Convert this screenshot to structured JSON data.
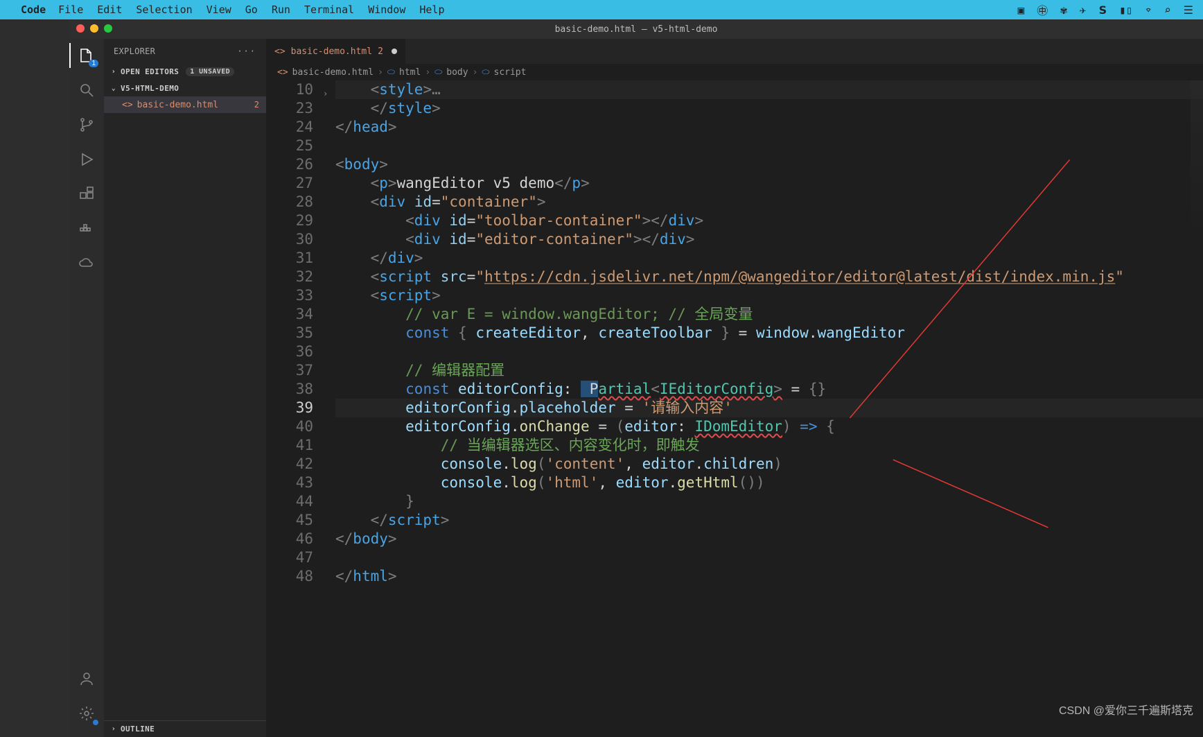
{
  "menubar": {
    "apple_glyph": "",
    "app": "Code",
    "items": [
      "File",
      "Edit",
      "Selection",
      "View",
      "Go",
      "Run",
      "Terminal",
      "Window",
      "Help"
    ]
  },
  "titlebar": "basic-demo.html — v5-html-demo",
  "activity_badge": "1",
  "sidebar": {
    "title": "EXPLORER",
    "open_editors_label": "OPEN EDITORS",
    "unsaved_label": "1 UNSAVED",
    "workspace_label": "V5-HTML-DEMO",
    "file_name": "basic-demo.html",
    "file_problems": "2",
    "outline_label": "OUTLINE"
  },
  "tab": {
    "label": "basic-demo.html",
    "problems": "2"
  },
  "breadcrumbs": [
    "basic-demo.html",
    "html",
    "body",
    "script"
  ],
  "line_numbers": [
    "10",
    "23",
    "24",
    "25",
    "26",
    "27",
    "28",
    "29",
    "30",
    "31",
    "32",
    "33",
    "34",
    "35",
    "36",
    "37",
    "38",
    "39",
    "40",
    "41",
    "42",
    "43",
    "44",
    "45",
    "46",
    "47",
    "48"
  ],
  "active_line_index": 17,
  "fold_markers": [
    0
  ],
  "code": {
    "l0": {
      "a": "    <",
      "b": "style",
      "c": ">",
      "d": "…"
    },
    "l1": {
      "a": "    </",
      "b": "style",
      "c": ">"
    },
    "l2": {
      "a": "</",
      "b": "head",
      "c": ">"
    },
    "l3": "",
    "l4": {
      "a": "<",
      "b": "body",
      "c": ">"
    },
    "l5": {
      "a": "    <",
      "b": "p",
      "c": ">",
      "t": "wangEditor v5 demo",
      "d": "</",
      "e": "p",
      "f": ">"
    },
    "l6": {
      "a": "    <",
      "b": "div",
      "sp": " ",
      "attr": "id",
      "eq": "=",
      "q": "\"",
      "v": "container",
      "q2": "\"",
      "c": ">"
    },
    "l7": {
      "a": "        <",
      "b": "div",
      "sp": " ",
      "attr": "id",
      "eq": "=",
      "q": "\"",
      "v": "toolbar-container",
      "q2": "\"",
      "c": "></",
      "b2": "div",
      "d": ">"
    },
    "l8": {
      "a": "        <",
      "b": "div",
      "sp": " ",
      "attr": "id",
      "eq": "=",
      "q": "\"",
      "v": "editor-container",
      "q2": "\"",
      "c": "></",
      "b2": "div",
      "d": ">"
    },
    "l9": {
      "a": "    </",
      "b": "div",
      "c": ">"
    },
    "l10": {
      "a": "    <",
      "b": "script",
      "sp": " ",
      "attr": "src",
      "eq": "=",
      "q": "\"",
      "url": "https://cdn.jsdelivr.net/npm/@wangeditor/editor@latest/dist/index.min.js",
      "q2": "\""
    },
    "l11": {
      "a": "    <",
      "b": "script",
      "c": ">"
    },
    "l12": {
      "c1": "        // var E = window.wangEditor; // ",
      "c2": "全局变量"
    },
    "l13": {
      "ind": "        ",
      "kw": "const",
      "sp": " ",
      "p1": "{ ",
      "v1": "createEditor",
      "c": ", ",
      "v2": "createToolbar",
      "p2": " }",
      "eq": " = ",
      "w": "window",
      "dot": ".",
      "m": "wangEditor"
    },
    "l14": "",
    "l15": {
      "c1": "        // ",
      "c2": "编辑器配置"
    },
    "l16": {
      "ind": "        ",
      "kw": "const",
      "sp": " ",
      "name": "editorConfig",
      "col": ": ",
      "tp": "Partial",
      "lt": "<",
      "tp2": "IEditorConfig",
      "gt": ">",
      "eq": " = ",
      "br": "{}"
    },
    "l17": {
      "ind": "        ",
      "v": "editorConfig",
      "dot": ".",
      "m": "placeholder",
      "eq": " = ",
      "q": "'",
      "s": "请输入内容",
      "q2": "'"
    },
    "l18": {
      "ind": "        ",
      "v": "editorConfig",
      "dot": ".",
      "m": "onChange",
      "eq": " = ",
      "p1": "(",
      "arg": "editor",
      "col": ": ",
      "tp": "IDomEditor",
      "p2": ")",
      "arrow": " => ",
      "br": "{"
    },
    "l19": {
      "c1": "            // ",
      "c2": "当编辑器选区、内容变化时，即触发"
    },
    "l20": {
      "ind": "            ",
      "o": "console",
      "dot": ".",
      "m": "log",
      "p1": "(",
      "q": "'",
      "s": "content",
      "q2": "'",
      "c": ", ",
      "o2": "editor",
      "dot2": ".",
      "m2": "children",
      "p2": ")"
    },
    "l21": {
      "ind": "            ",
      "o": "console",
      "dot": ".",
      "m": "log",
      "p1": "(",
      "q": "'",
      "s": "html",
      "q2": "'",
      "c": ", ",
      "o2": "editor",
      "dot2": ".",
      "m2": "getHtml",
      "call": "()",
      "p2": ")"
    },
    "l22": {
      "ind": "        ",
      "br": "}"
    },
    "l23": {
      "a": "    </",
      "b": "script",
      "c": ">"
    },
    "l24": {
      "a": "</",
      "b": "body",
      "c": ">"
    },
    "l25": "",
    "l26": {
      "a": "</",
      "b": "html",
      "c": ">"
    }
  },
  "watermark": "CSDN @爱你三千遍斯塔克"
}
